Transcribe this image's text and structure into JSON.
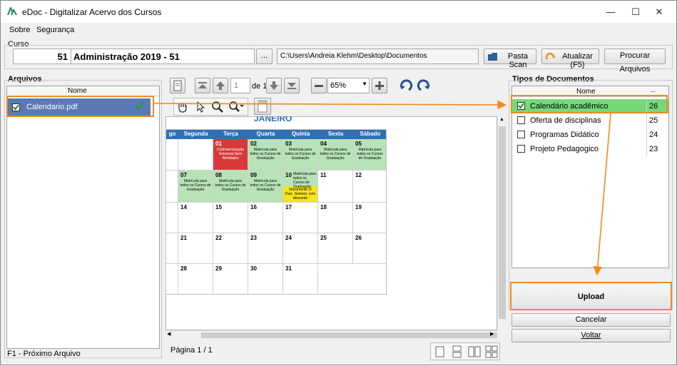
{
  "window": {
    "title": "eDoc - Digitalizar Acervo dos Cursos",
    "minimize": "—",
    "maximize": "☐",
    "close": "✕"
  },
  "menu": {
    "items": [
      "Sobre",
      "Segurança"
    ]
  },
  "curso": {
    "label": "Curso",
    "code": "51",
    "name": "Administração 2019 - 51",
    "browse": "...",
    "path": "C:\\Users\\Andreia Klehm\\Desktop\\Documentos",
    "pasta_scan": "Pasta Scan",
    "atualizar": "Atualizar (F5)",
    "procurar": "Procurar Arquivos"
  },
  "arquivos": {
    "label": "Arquivos",
    "column": "Nome",
    "files": [
      {
        "name": "Calendario.pdf",
        "checked": true
      }
    ],
    "footer": "F1 - Próximo Arquivo"
  },
  "viewer": {
    "page_input": "1",
    "page_of": "de 1",
    "zoom": "65%",
    "page_status": "Página 1 / 1"
  },
  "calendar": {
    "partial_title": "JANEIRO",
    "days": [
      "go",
      "Segunda",
      "Terça",
      "Quarta",
      "Quinta",
      "Sexta",
      "Sábado"
    ],
    "rows": [
      [
        {
          "d": ""
        },
        {
          "d": ""
        },
        {
          "d": "01",
          "note": "Confraternização Universal Sem Atividades",
          "type": "red"
        },
        {
          "d": "02",
          "note": "Matrícula para todos os Cursos de Graduação",
          "type": "green"
        },
        {
          "d": "03",
          "note": "Matrícula para todos os Cursos de Graduação",
          "type": "green"
        },
        {
          "d": "04",
          "note": "Matrícula para todos os Cursos de Graduação",
          "type": "green"
        },
        {
          "d": "05",
          "note": "Matrícula para todos os Cursos de Graduação",
          "type": "green"
        }
      ],
      [
        {
          "d": ""
        },
        {
          "d": "07",
          "note": "Matrícula para todos os Cursos de Graduação",
          "type": "green"
        },
        {
          "d": "08",
          "note": "Matrícula para todos os Cursos de Graduação",
          "type": "green"
        },
        {
          "d": "09",
          "note": "Matrícula para todos os Cursos de Graduação",
          "type": "green"
        },
        {
          "d": "10",
          "note": "Matrícula para todos os Cursos de Graduação",
          "note2": "Vencimento 1ª Parc. Semest. com desconto",
          "type": "split"
        },
        {
          "d": "11"
        },
        {
          "d": "12"
        }
      ],
      [
        {
          "d": ""
        },
        {
          "d": "14"
        },
        {
          "d": "15"
        },
        {
          "d": "16"
        },
        {
          "d": "17"
        },
        {
          "d": "18"
        },
        {
          "d": "19"
        }
      ],
      [
        {
          "d": ""
        },
        {
          "d": "21"
        },
        {
          "d": "22"
        },
        {
          "d": "23"
        },
        {
          "d": "24"
        },
        {
          "d": "25"
        },
        {
          "d": "26"
        }
      ],
      [
        {
          "d": ""
        },
        {
          "d": "28"
        },
        {
          "d": "29"
        },
        {
          "d": "30"
        },
        {
          "d": "31"
        }
      ]
    ]
  },
  "tipos": {
    "label": "Tipos de Documentos",
    "col_name": "Nome",
    "col_extra": "...",
    "items": [
      {
        "name": "Calendário acadêmico",
        "count": "26",
        "checked": true
      },
      {
        "name": "Oferta de disciplinas",
        "count": "25",
        "checked": false
      },
      {
        "name": "Programas Didático",
        "count": "24",
        "checked": false
      },
      {
        "name": "Projeto Pedagogico",
        "count": "23",
        "checked": false
      }
    ]
  },
  "actions": {
    "upload": "Upload",
    "cancelar": "Cancelar",
    "voltar": "Voltar"
  },
  "colors": {
    "highlight_orange": "#f28a1c",
    "selected_blue": "#5b79b5",
    "selected_green": "#75d97a",
    "cal_header": "#2f6fb7"
  }
}
